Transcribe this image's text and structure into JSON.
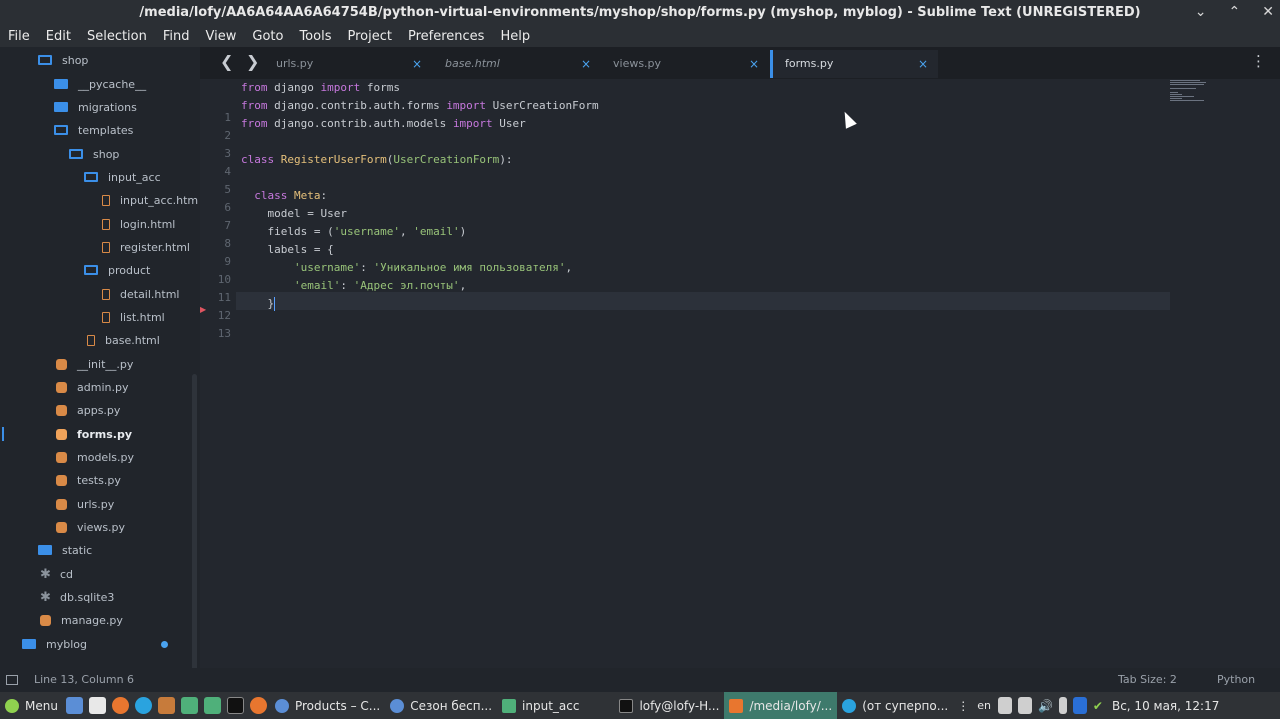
{
  "window": {
    "title": "/media/lofy/AA6A64AA6A64754B/python-virtual-environments/myshop/shop/forms.py (myshop, myblog) - Sublime Text (UNREGISTERED)"
  },
  "menu": [
    "File",
    "Edit",
    "Selection",
    "Find",
    "View",
    "Goto",
    "Tools",
    "Project",
    "Preferences",
    "Help"
  ],
  "sidebar": [
    {
      "label": "shop",
      "icon": "folder-open-icon"
    },
    {
      "label": "__pycache__",
      "icon": "folder-icon"
    },
    {
      "label": "migrations",
      "icon": "folder-icon"
    },
    {
      "label": "templates",
      "icon": "folder-open-icon"
    },
    {
      "label": "shop",
      "icon": "folder-open-icon"
    },
    {
      "label": "input_acc",
      "icon": "folder-open-icon"
    },
    {
      "label": "input_acc.htm",
      "icon": "html-file-icon"
    },
    {
      "label": "login.html",
      "icon": "html-file-icon"
    },
    {
      "label": "register.html",
      "icon": "html-file-icon"
    },
    {
      "label": "product",
      "icon": "folder-open-icon"
    },
    {
      "label": "detail.html",
      "icon": "html-file-icon"
    },
    {
      "label": "list.html",
      "icon": "html-file-icon"
    },
    {
      "label": "base.html",
      "icon": "html-file-icon"
    },
    {
      "label": "__init__.py",
      "icon": "python-file-icon"
    },
    {
      "label": "admin.py",
      "icon": "python-file-icon"
    },
    {
      "label": "apps.py",
      "icon": "python-file-icon"
    },
    {
      "label": "forms.py",
      "icon": "python-file-icon"
    },
    {
      "label": "models.py",
      "icon": "python-file-icon"
    },
    {
      "label": "tests.py",
      "icon": "python-file-icon"
    },
    {
      "label": "urls.py",
      "icon": "python-file-icon"
    },
    {
      "label": "views.py",
      "icon": "python-file-icon"
    },
    {
      "label": "static",
      "icon": "folder-icon"
    },
    {
      "label": "cd",
      "icon": "file-icon"
    },
    {
      "label": "db.sqlite3",
      "icon": "file-icon"
    },
    {
      "label": "manage.py",
      "icon": "python-file-icon"
    },
    {
      "label": "myblog",
      "icon": "folder-icon"
    }
  ],
  "tabs": [
    {
      "label": "urls.py",
      "close": "×"
    },
    {
      "label": "base.html",
      "close": "×"
    },
    {
      "label": "views.py",
      "close": "×"
    },
    {
      "label": "forms.py",
      "close": "×"
    }
  ],
  "code": {
    "line_numbers": [
      "1",
      "2",
      "3",
      "4",
      "5",
      "6",
      "7",
      "8",
      "9",
      "10",
      "11",
      "12",
      "13"
    ],
    "l1": {
      "a": "from",
      "b": " django ",
      "c": "import",
      "d": " forms"
    },
    "l2": {
      "a": "from",
      "b": " django.contrib.auth.forms ",
      "c": "import",
      "d": " UserCreationForm"
    },
    "l3": {
      "a": "from",
      "b": " django.contrib.auth.models ",
      "c": "import",
      "d": " User"
    },
    "l5": {
      "a": "class",
      "b": " ",
      "c": "RegisterUserForm",
      "d": "(",
      "e": "UserCreationForm",
      "f": "):"
    },
    "l7": {
      "a": "  class",
      "b": " ",
      "c": "Meta",
      "d": ":"
    },
    "l8": "    model = User",
    "l9": {
      "a": "    fields = (",
      "b": "'username'",
      "c": ", ",
      "d": "'email'",
      "e": ")"
    },
    "l10": "    labels = {",
    "l11": {
      "a": "        ",
      "b": "'username'",
      "c": ": ",
      "d": "'Уникальное имя пользователя'",
      "e": ","
    },
    "l12": {
      "a": "        ",
      "b": "'email'",
      "c": ": ",
      "d": "'Адрес эл.почты'",
      "e": ","
    },
    "l13": "    }"
  },
  "status": {
    "position": "Line 13, Column 6",
    "tab_size": "Tab Size: 2",
    "syntax": "Python"
  },
  "taskbar": {
    "menu": "Menu",
    "items": [
      "Products – C...",
      "Сезон бесп...",
      "input_acc",
      "lofy@lofy-H...",
      "/media/lofy/...",
      "(от суперпо..."
    ],
    "lang": "en",
    "clock": "Вс, 10 мая, 12:17"
  }
}
